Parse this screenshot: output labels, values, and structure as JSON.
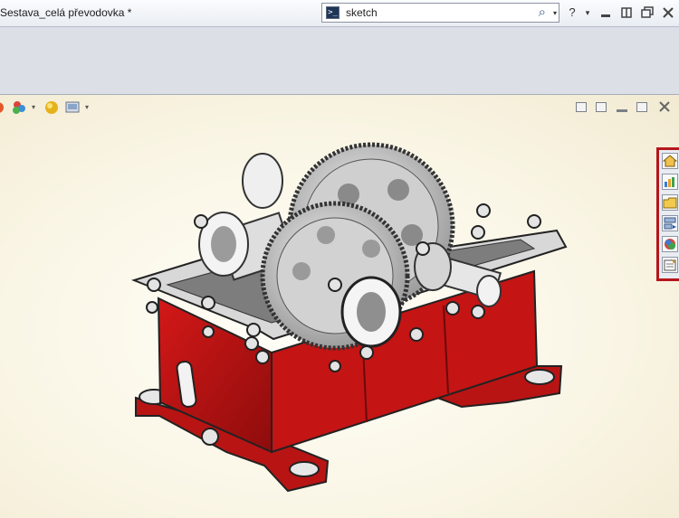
{
  "window": {
    "title": "Sestava_celá převodovka *",
    "help_glyph": "?",
    "caret_glyph": "▾"
  },
  "search": {
    "cmd_glyph": ">_",
    "text": "sketch",
    "magnifier_glyph": "⌕"
  },
  "taskpane": {
    "items": [
      "home",
      "resources",
      "design-library",
      "file-explorer",
      "appearances",
      "custom-properties"
    ]
  },
  "colors": {
    "housing_red": "#c41414",
    "housing_dark": "#8e0c0c",
    "gear_grey": "#c9c9c9",
    "taskpane_border": "#b5161c"
  }
}
